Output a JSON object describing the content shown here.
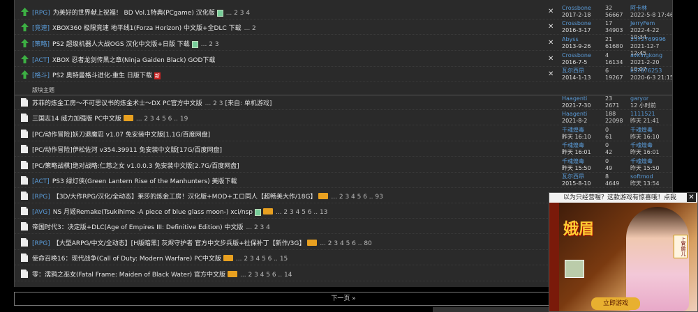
{
  "topics": [
    {
      "kind": "sticky",
      "tag": "[RPG]",
      "title": "为美好的世界献上祝福！ BD Vol.1特典(PCgame) 汉化版",
      "attach": true,
      "newbadge": false,
      "hot": false,
      "pages": "... 2 3 4",
      "extra": "",
      "closable": true,
      "author": "Crossbone",
      "date": "2017-2-18",
      "replies": "32",
      "views": "56667",
      "last_user": "阿卡林",
      "last_time": "2022-5-8 17:46"
    },
    {
      "kind": "sticky",
      "tag": "[竞速]",
      "title": "XBOX360 极限竞速 地平线1(Forza Horizon) 中文版+全DLC 下载",
      "attach": false,
      "newbadge": false,
      "hot": false,
      "pages": "... 2",
      "extra": "",
      "closable": true,
      "author": "Crossbone",
      "date": "2016-3-17",
      "replies": "17",
      "views": "34903",
      "last_user": "JerryFem",
      "last_time": "2022-4-22 10:34"
    },
    {
      "kind": "sticky",
      "tag": "[策略]",
      "title": "PS2 超级机器人大战OGS 汉化中文版+日版 下载",
      "attach": true,
      "newbadge": false,
      "hot": false,
      "pages": "... 2 3",
      "extra": "",
      "closable": true,
      "author": "Abyss",
      "date": "2013-9-26",
      "replies": "21",
      "views": "61680",
      "last_user": "2572769996",
      "last_time": "2021-12-7 12:45"
    },
    {
      "kind": "sticky",
      "tag": "[ACT]",
      "title": "XBOX 忍者龙剑传黑之章(Ninja Gaiden Black) GOD下载",
      "attach": false,
      "newbadge": false,
      "hot": false,
      "pages": "",
      "extra": "",
      "closable": true,
      "author": "Crossbone",
      "date": "2016-7-5",
      "replies": "4",
      "views": "16134",
      "last_user": "avkingkong",
      "last_time": "2021-2-20 10:07"
    },
    {
      "kind": "sticky",
      "tag": "[格斗]",
      "title": "PS2 奥特曼格斗进化-重生 日版下载",
      "attach": false,
      "newbadge": true,
      "hot": false,
      "pages": "",
      "extra": "",
      "closable": true,
      "author": "瓦尔西昂",
      "date": "2014-1-13",
      "replies": "6",
      "views": "19267",
      "last_user": "k57876253",
      "last_time": "2020-6-3 21:15"
    },
    {
      "kind": "normal",
      "tag": "",
      "title": "苏菲的炼金工房～不可思议书的炼金术士～DX PC官方中文版",
      "attach": false,
      "newbadge": false,
      "hot": false,
      "pages": "... 2 3",
      "extra": "[来自: 单机游戏]",
      "closable": false,
      "author": "Haagenti",
      "date": "2021-7-30",
      "replies": "23",
      "views": "2671",
      "last_user": "garyor",
      "last_time": "12 小时前"
    },
    {
      "kind": "normal",
      "tag": "",
      "title": "三国志14 威力加强版 PC中文版",
      "attach": false,
      "newbadge": false,
      "hot": true,
      "pages": "... 2 3 4 5 6 .. 19",
      "extra": "",
      "closable": false,
      "author": "Haagenti",
      "date": "2021-8-2",
      "replies": "188",
      "views": "22098",
      "last_user": "1111521",
      "last_time": "昨天 21:41"
    },
    {
      "kind": "normal",
      "tag": "",
      "title": "[PC/动作冒险]妖刀退魔忍 v1.07 免安装中文版[1.1G/百度网盘]",
      "attach": false,
      "newbadge": false,
      "hot": false,
      "pages": "",
      "extra": "",
      "closable": false,
      "author": "千魂煌毒",
      "date": "昨天 16:10",
      "replies": "0",
      "views": "61",
      "last_user": "千魂煌毒",
      "last_time": "昨天 16:10"
    },
    {
      "kind": "normal",
      "tag": "",
      "title": "[PC/动作冒险]伊松佐河 v354.39911 免安装中文版[17G/百度网盘]",
      "attach": false,
      "newbadge": false,
      "hot": false,
      "pages": "",
      "extra": "",
      "closable": false,
      "author": "千魂煌毒",
      "date": "昨天 16:01",
      "replies": "0",
      "views": "42",
      "last_user": "千魂煌毒",
      "last_time": "昨天 16:01"
    },
    {
      "kind": "normal",
      "tag": "",
      "title": "[PC/策略战棋]绝对战略:仁慈之女 v1.0.0.3 免安装中文版[2.7G/百度网盘]",
      "attach": false,
      "newbadge": false,
      "hot": false,
      "pages": "",
      "extra": "",
      "closable": false,
      "author": "千魂煌毒",
      "date": "昨天 15:50",
      "replies": "0",
      "views": "49",
      "last_user": "千魂煌毒",
      "last_time": "昨天 15:50"
    },
    {
      "kind": "normal",
      "tag": "[ACT]",
      "title": "PS3 绿灯侠(Green Lantern Rise of the Manhunters) 美版下载",
      "attach": false,
      "newbadge": false,
      "hot": false,
      "pages": "",
      "extra": "",
      "closable": false,
      "author": "瓦尔西昂",
      "date": "2015-8-10",
      "replies": "8",
      "views": "4649",
      "last_user": "softmod",
      "last_time": "昨天 13:54"
    },
    {
      "kind": "normal",
      "tag": "[RPG]",
      "title": "【3D/大作RPG/汉化/全动态】莱莎的炼金工房！汉化版+MOD+エロ同人【超畅美大作/18G】",
      "attach": false,
      "newbadge": false,
      "hot": true,
      "pages": "... 2 3 4 5 6 .. 93",
      "extra": "",
      "closable": false,
      "author": "",
      "date": "",
      "replies": "",
      "views": "",
      "last_user": "",
      "last_time": ""
    },
    {
      "kind": "normal",
      "tag": "[AVG]",
      "title": "NS 月姬Remake(Tsukihime -A piece of blue glass moon-) xci/nsp",
      "attach": true,
      "newbadge": false,
      "hot": true,
      "pages": "... 2 3 4 5 6 .. 13",
      "extra": "",
      "closable": false,
      "author": "",
      "date": "",
      "replies": "",
      "views": "",
      "last_user": "",
      "last_time": ""
    },
    {
      "kind": "normal",
      "tag": "",
      "title": "帝国时代3：决定版+DLC(Age of Empires III: Definitive Edition) 中文版",
      "attach": false,
      "newbadge": false,
      "hot": false,
      "pages": "... 2 3 4",
      "extra": "",
      "closable": false,
      "author": "",
      "date": "",
      "replies": "",
      "views": "",
      "last_user": "",
      "last_time": ""
    },
    {
      "kind": "normal",
      "tag": "[RPG]",
      "title": "【大型ARPG/中文/全动态】[H版暗黑] 灰烬守护者 官方中文步兵版+社保补丁【新作/3G】",
      "attach": false,
      "newbadge": false,
      "hot": true,
      "pages": "... 2 3 4 5 6 .. 80",
      "extra": "",
      "closable": false,
      "author": "",
      "date": "",
      "replies": "",
      "views": "",
      "last_user": "",
      "last_time": ""
    },
    {
      "kind": "normal",
      "tag": "",
      "title": "使命召唤16：现代战争(Call of Duty: Modern Warfare) PC中文版",
      "attach": false,
      "newbadge": false,
      "hot": true,
      "pages": "... 2 3 4 5 6 .. 15",
      "extra": "",
      "closable": false,
      "author": "",
      "date": "",
      "replies": "",
      "views": "",
      "last_user": "",
      "last_time": ""
    },
    {
      "kind": "normal",
      "tag": "",
      "title": "零：濡鸦之巫女(Fatal Frame: Maiden of Black Water) 官方中文版",
      "attach": false,
      "newbadge": false,
      "hot": true,
      "pages": "... 2 3 4 5 6 .. 14",
      "extra": "",
      "closable": false,
      "author": "",
      "date": "",
      "replies": "",
      "views": "",
      "last_user": "",
      "last_time": ""
    }
  ],
  "section_label": "版块主题",
  "next_page": "下一页 »",
  "ad": {
    "header": "以为只经营喔？这款游戏有惊喜哦！点我",
    "close": "✕",
    "logo": "娥眉",
    "button": "立即游戏",
    "sign": "上官婉儿"
  }
}
